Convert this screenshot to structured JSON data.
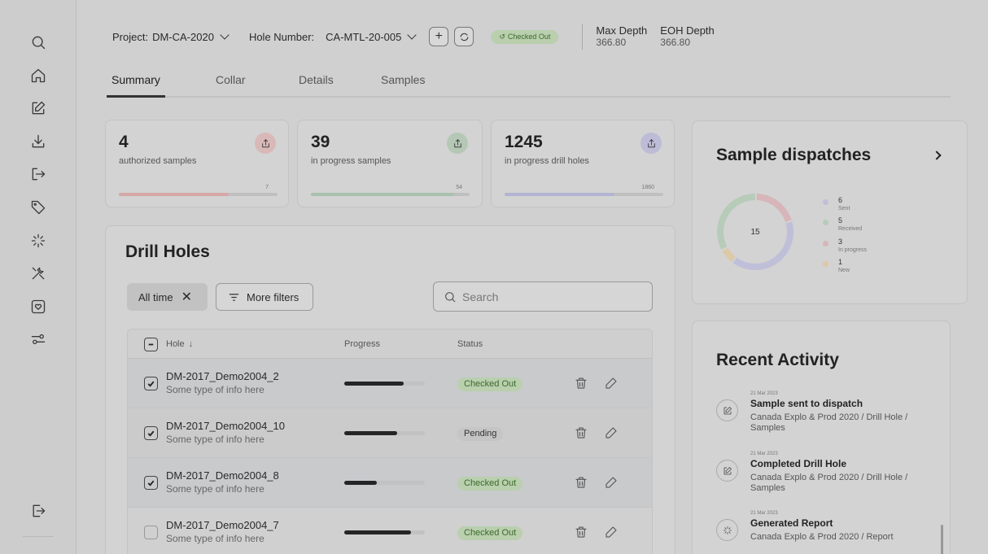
{
  "topbar": {
    "project_label": "Project:",
    "project_value": "DM-CA-2020",
    "hole_label": "Hole Number:",
    "hole_value": "CA-MTL-20-005",
    "add_label": "+",
    "status_badge": "Checked Out",
    "max_depth_label": "Max Depth",
    "max_depth_value": "366.80",
    "eoh_depth_label": "EOH Depth",
    "eoh_depth_value": "366.80"
  },
  "tabs": [
    "Summary",
    "Collar",
    "Details",
    "Samples"
  ],
  "stats": [
    {
      "value": "4",
      "label": "authorized samples",
      "max": "7",
      "progress": 0.69,
      "color": "#d6a7a7",
      "icon_bg": "#d9b8b8"
    },
    {
      "value": "39",
      "label": "in progress samples",
      "max": "54",
      "progress": 0.9,
      "color": "#a8c2ad",
      "icon_bg": "#b5c7b5"
    },
    {
      "value": "1245",
      "label": "in progress drill holes",
      "max": "1860",
      "progress": 0.69,
      "color": "#b3b4d2",
      "icon_bg": "#bcbcd6"
    }
  ],
  "drill_holes": {
    "title": "Drill Holes",
    "filter_all_time": "All time",
    "filter_more": "More filters",
    "search_placeholder": "Search",
    "columns": {
      "hole": "Hole",
      "progress": "Progress",
      "status": "Status"
    },
    "rows": [
      {
        "name": "DM-2017_Demo2004_2",
        "info": "Some type of info here",
        "progress": 0.74,
        "status": "Checked Out",
        "selected": true
      },
      {
        "name": "DM-2017_Demo2004_10",
        "info": "Some type of info here",
        "progress": 0.66,
        "status": "Pending",
        "selected": true
      },
      {
        "name": "DM-2017_Demo2004_8",
        "info": "Some type of info here",
        "progress": 0.4,
        "status": "Checked Out",
        "selected": true
      },
      {
        "name": "DM-2017_Demo2004_7",
        "info": "Some type of info here",
        "progress": 0.83,
        "status": "Checked Out",
        "selected": false
      }
    ]
  },
  "sample_dispatches": {
    "title": "Sample dispatches",
    "total": "15",
    "segments": [
      {
        "value": "6",
        "label": "Sent",
        "color": "#bfbfda"
      },
      {
        "value": "5",
        "label": "Received",
        "color": "#b6cbb8"
      },
      {
        "value": "3",
        "label": "In progress",
        "color": "#d7b5b9"
      },
      {
        "value": "1",
        "label": "New",
        "color": "#dcc9a6"
      }
    ]
  },
  "recent_activity": {
    "title": "Recent Activity",
    "items": [
      {
        "date": "21 Mar 2023",
        "title": "Sample sent to dispatch",
        "desc": "Canada Explo & Prod 2020 / Drill Hole / Samples",
        "icon": "edit-icon"
      },
      {
        "date": "21 Mar 2023",
        "title": "Completed Drill Hole",
        "desc": "Canada Explo & Prod 2020 / Drill Hole / Samples",
        "icon": "edit-icon"
      },
      {
        "date": "21 Mar 2023",
        "title": "Generated Report",
        "desc": "Canada Explo & Prod 2020 / Report",
        "icon": "loader-icon"
      }
    ]
  }
}
